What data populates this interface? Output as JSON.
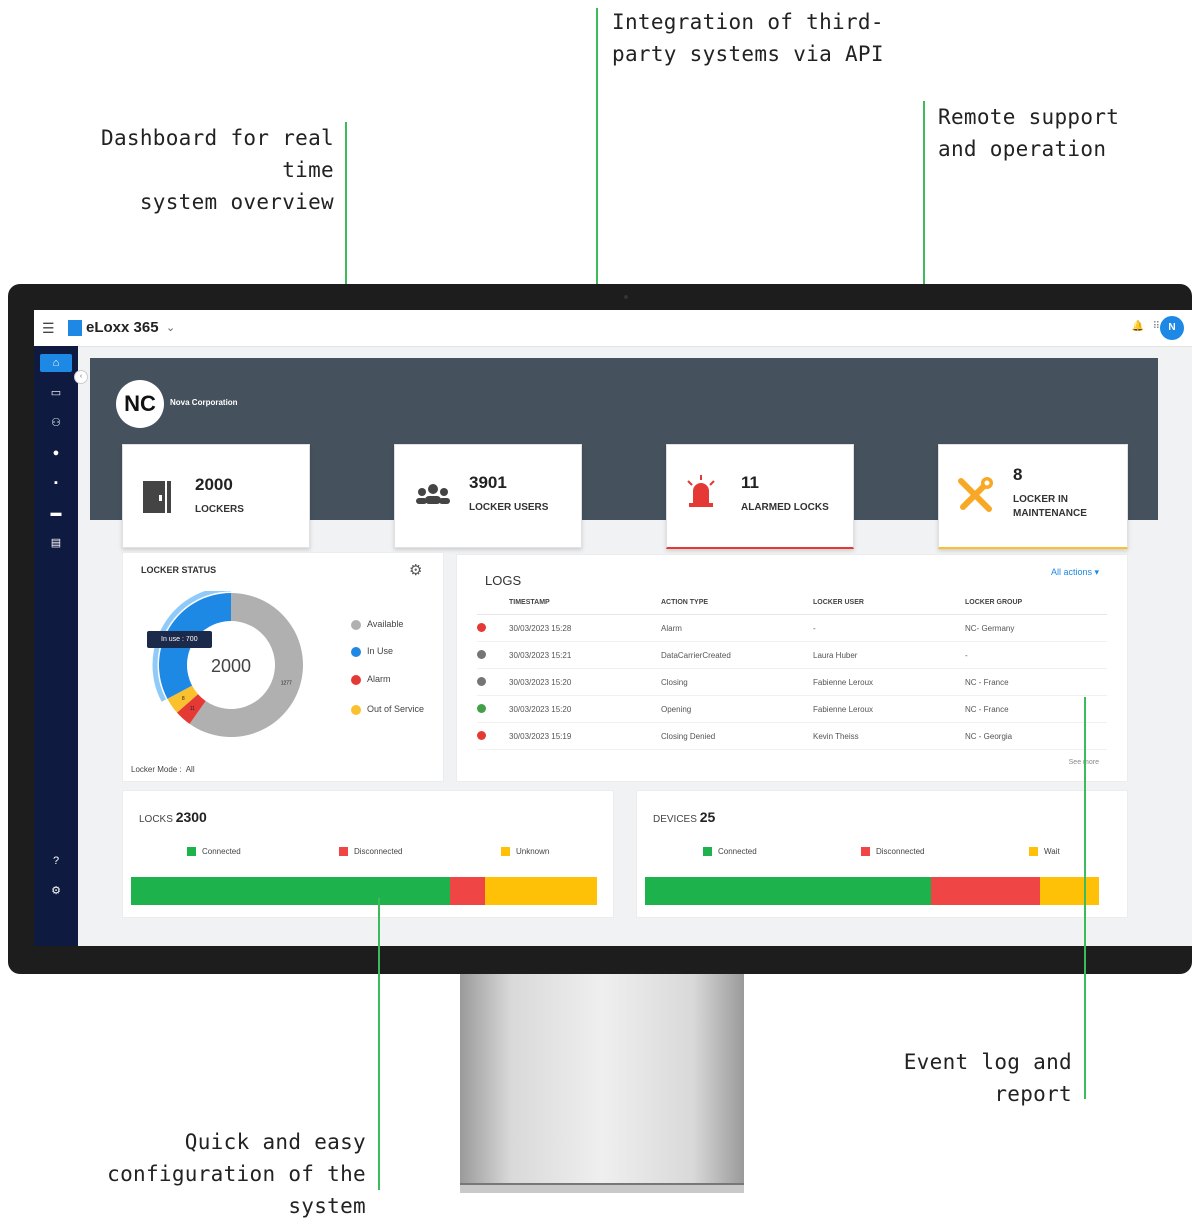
{
  "callouts": {
    "dashboard_line1": "Dashboard for real time",
    "dashboard_line2": "system overview",
    "integration_line1": "Integration of third-",
    "integration_line2": "party systems via API",
    "remote_line1": "Remote support",
    "remote_line2": "and operation",
    "event_line1": "Event log and",
    "event_line2": "report",
    "config_line1": "Quick and easy",
    "config_line2": "configuration of the system"
  },
  "app": {
    "name": "eLoxx 365",
    "avatar_initial": "N"
  },
  "sidebar": {
    "items": [
      "home-icon",
      "wallet-icon",
      "people-icon",
      "person-badge-icon",
      "document-icon",
      "monitor-icon",
      "card-icon"
    ],
    "help": "?",
    "brand": "NC"
  },
  "banner": {
    "logo_text": "NC",
    "company": "Nova Corporation"
  },
  "kpis": [
    {
      "value": "2000",
      "label": "LOCKERS",
      "icon": "locker-icon",
      "accent": ""
    },
    {
      "value": "3901",
      "label": "LOCKER USERS",
      "icon": "users-icon",
      "accent": ""
    },
    {
      "value": "11",
      "label": "ALARMED LOCKS",
      "icon": "siren-icon",
      "accent": "#e53935"
    },
    {
      "value": "8",
      "label": "LOCKER IN MAINTENANCE",
      "icon": "tools-icon",
      "accent": "#fbc02d"
    }
  ],
  "locker_status": {
    "title": "LOCKER STATUS",
    "center_total": "2000",
    "tooltip": "In use : 700",
    "slice_labels": {
      "in_use": "700",
      "available": "1277",
      "alarm": "11",
      "out_of_service": "8"
    },
    "mode_label": "Locker Mode :",
    "mode_value": "All",
    "legend": [
      {
        "label": "Available",
        "color": "#b0b0b0"
      },
      {
        "label": "In Use",
        "color": "#1e88e5"
      },
      {
        "label": "Alarm",
        "color": "#e53935"
      },
      {
        "label": "Out of Service",
        "color": "#fbc02d"
      }
    ],
    "colors": {
      "available": "#b0b0b0",
      "in_use": "#1e88e5",
      "alarm": "#e53935",
      "out_of_service": "#fbc02d"
    }
  },
  "logs": {
    "title": "LOGS",
    "filter": "All actions ▾",
    "see_more": "See more",
    "columns": [
      "TIMESTAMP",
      "ACTION TYPE",
      "LOCKER USER",
      "LOCKER GROUP"
    ],
    "rows": [
      {
        "status_color": "#e53935",
        "timestamp": "30/03/2023 15:28",
        "action": "Alarm",
        "user": "-",
        "group": "NC- Germany"
      },
      {
        "status_color": "#757575",
        "timestamp": "30/03/2023 15:21",
        "action": "DataCarrierCreated",
        "user": "Laura Huber",
        "group": "-"
      },
      {
        "status_color": "#757575",
        "timestamp": "30/03/2023 15:20",
        "action": "Closing",
        "user": "Fabienne Leroux",
        "group": "NC - France"
      },
      {
        "status_color": "#43a047",
        "timestamp": "30/03/2023 15:20",
        "action": "Opening",
        "user": "Fabienne Leroux",
        "group": "NC - France"
      },
      {
        "status_color": "#e53935",
        "timestamp": "30/03/2023 15:19",
        "action": "Closing Denied",
        "user": "Kevin Theiss",
        "group": "NC - Georgia"
      }
    ]
  },
  "locks": {
    "title": "LOCKS",
    "count": "2300",
    "legend": [
      {
        "label": "Connected",
        "color": "#1db24b"
      },
      {
        "label": "Disconnected",
        "color": "#f04545"
      },
      {
        "label": "Unknown",
        "color": "#ffc107"
      }
    ],
    "fractions": [
      0.685,
      0.075,
      0.24
    ]
  },
  "devices": {
    "title": "DEVICES",
    "count": "25",
    "legend": [
      {
        "label": "Connected",
        "color": "#1db24b"
      },
      {
        "label": "Disconnected",
        "color": "#f04545"
      },
      {
        "label": "Wait",
        "color": "#ffc107"
      }
    ],
    "fractions": [
      0.63,
      0.24,
      0.13
    ]
  }
}
